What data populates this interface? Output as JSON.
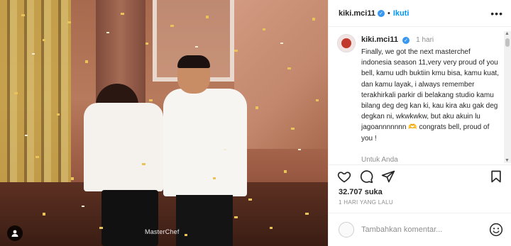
{
  "post": {
    "username": "kiki.mci11",
    "verified_badge": "✓",
    "follow_label": "Ikuti",
    "more_label": "•••",
    "watermark": "MasterChef"
  },
  "caption": {
    "username": "kiki.mci11",
    "time": "1 hari",
    "text": "Finally, we got the next masterchef indonesia season 11,very very proud of you bell, kamu udh buktiin kmu bisa, kamu kuat, dan kamu layak, i always remember terakhirkali parkir di belakang studio kamu bilang deg deg kan ki, kau kira aku gak deg degkan ni, wkwkwkw, but aku akuin lu jagoannnnnnn 🫶 congrats bell, proud of you !",
    "more_label": "Untuk Anda"
  },
  "stats": {
    "likes": "32.707 suka",
    "when": "1 HARI YANG LALU"
  },
  "comment": {
    "placeholder": "Tambahkan komentar..."
  },
  "icons": {
    "like": "heart-icon",
    "comment": "comment-icon",
    "share": "share-icon",
    "save": "bookmark-icon",
    "emoji": "emoji-icon",
    "tag": "user-tag-icon"
  },
  "colors": {
    "accent": "#0095f6",
    "verified": "#3897f0",
    "muted": "#8e8e8e"
  }
}
